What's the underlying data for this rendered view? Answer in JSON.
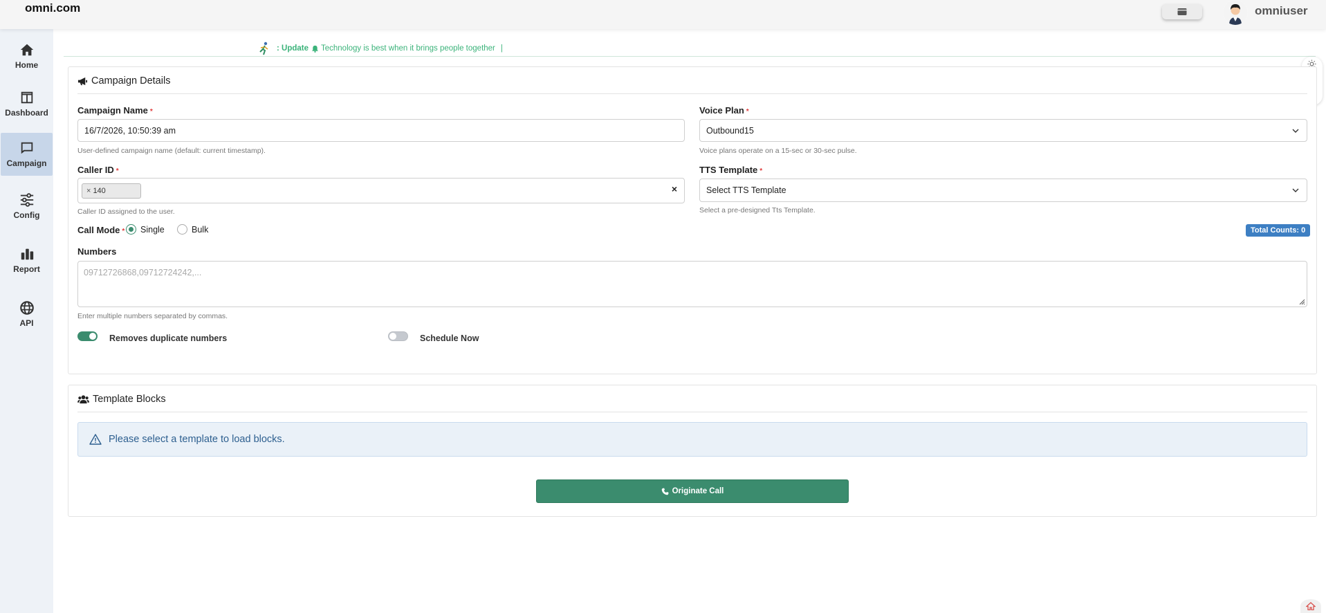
{
  "header": {
    "brand": "omni.com",
    "username": "omniuser"
  },
  "sidebar": {
    "items": [
      {
        "label": "Home",
        "icon": "home-icon"
      },
      {
        "label": "Dashboard",
        "icon": "dashboard-icon"
      },
      {
        "label": "Campaign",
        "icon": "chat-icon",
        "active": true
      },
      {
        "label": "Config",
        "icon": "sliders-icon"
      },
      {
        "label": "Report",
        "icon": "bar-chart-icon"
      },
      {
        "label": "API",
        "icon": "globe-icon"
      }
    ]
  },
  "ticker": {
    "prefix": ": Update",
    "message": "Technology is best when it brings people together",
    "cursor": "|"
  },
  "campaign": {
    "title": "Campaign Details",
    "campaign_name": {
      "label": "Campaign Name",
      "required": "*",
      "value": "16/7/2026, 10:50:39 am",
      "help": "User-defined campaign name (default: current timestamp)."
    },
    "voice_plan": {
      "label": "Voice Plan",
      "required": "*",
      "value": "Outbound15",
      "help": "Voice plans operate on a 15-sec or 30-sec pulse."
    },
    "caller_id": {
      "label": "Caller ID",
      "required": "*",
      "tag_remove": "×",
      "tag_value": "140",
      "clear": "×",
      "help": "Caller ID assigned to the user."
    },
    "tts_template": {
      "label": "TTS Template",
      "required": "*",
      "value": "Select TTS Template",
      "help": "Select a pre-designed Tts Template."
    },
    "call_mode": {
      "label": "Call Mode",
      "required": "*",
      "options": [
        "Single",
        "Bulk"
      ],
      "selected": "Single"
    },
    "total_counts": "Total Counts: 0",
    "numbers": {
      "label": "Numbers",
      "placeholder": "09712726868,09712724242,...",
      "help": "Enter multiple numbers separated by commas."
    },
    "toggles": {
      "remove_duplicates": {
        "label": "Removes duplicate numbers",
        "on": true
      },
      "schedule_now": {
        "label": "Schedule Now",
        "on": false
      }
    }
  },
  "template_blocks": {
    "title": "Template Blocks",
    "alert": "Please select a template to load blocks.",
    "button": "Originate Call"
  },
  "colors": {
    "primary": "#3b8c6e",
    "ticker": "#3bb37a",
    "badge": "#3d7fc3",
    "sidebar_active": "#c7d6e9"
  }
}
